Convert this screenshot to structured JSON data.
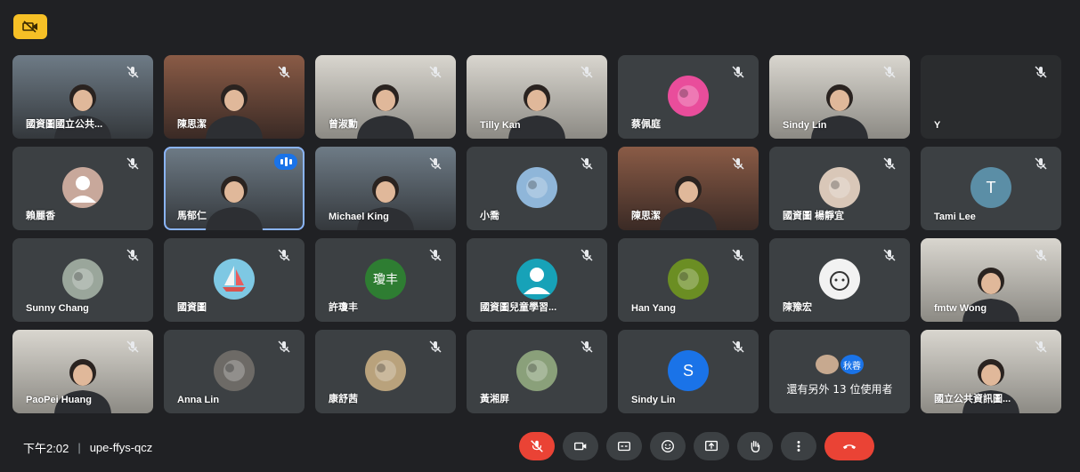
{
  "top_badge_icon": "no-camera-badge-icon",
  "participants": [
    {
      "name": "國資圖國立公共...",
      "kind": "video",
      "tone": "cool"
    },
    {
      "name": "陳思潔",
      "kind": "video",
      "tone": "warm"
    },
    {
      "name": "曾淑勳",
      "kind": "video",
      "tone": "light"
    },
    {
      "name": "Tilly Kan",
      "kind": "video",
      "tone": "light"
    },
    {
      "name": "蔡佩庭",
      "kind": "avatar",
      "avatar_color": "#e94d9b",
      "avatar_icon": "sunset-photo"
    },
    {
      "name": "Sindy Lin",
      "kind": "video",
      "tone": "light"
    },
    {
      "name": "Y",
      "kind": "video",
      "tone": "dark"
    },
    {
      "name": "賴麗香",
      "kind": "avatar",
      "avatar_color": "#c8a89b",
      "avatar_icon": "person-silhouette"
    },
    {
      "name": "馬郁仁",
      "kind": "video",
      "tone": "cool",
      "speaking": true
    },
    {
      "name": "Michael King",
      "kind": "video",
      "tone": "cool"
    },
    {
      "name": "小喬",
      "kind": "avatar",
      "avatar_color": "#8fb6d9",
      "avatar_icon": "building-photo"
    },
    {
      "name": "陳思潔",
      "kind": "video",
      "tone": "warm"
    },
    {
      "name": "國資圖 楊靜宜",
      "kind": "avatar",
      "avatar_color": "#d9c7b8",
      "avatar_icon": "person-photo"
    },
    {
      "name": "Tami Lee",
      "kind": "avatar",
      "avatar_color": "#5b8ea6",
      "avatar_letter": "T"
    },
    {
      "name": "Sunny Chang",
      "kind": "avatar",
      "avatar_color": "#9aa69b",
      "avatar_icon": "cat-photo"
    },
    {
      "name": "國資圖",
      "kind": "avatar",
      "avatar_color": "#7ec8e3",
      "avatar_icon": "sailboat"
    },
    {
      "name": "許瓊丰",
      "kind": "avatar",
      "avatar_color": "#2e7d32",
      "avatar_letter": "瓊丰"
    },
    {
      "name": "國資圖兒童學習...",
      "kind": "avatar",
      "avatar_color": "#17a2b8",
      "avatar_icon": "person-silhouette"
    },
    {
      "name": "Han Yang",
      "kind": "avatar",
      "avatar_color": "#6b8e23",
      "avatar_icon": "flower-photo"
    },
    {
      "name": "陳豫宏",
      "kind": "avatar",
      "avatar_color": "#f2f2f2",
      "avatar_icon": "cartoon-face"
    },
    {
      "name": "fmtw Wong",
      "kind": "video",
      "tone": "light"
    },
    {
      "name": "PaoPei Huang",
      "kind": "video",
      "tone": "light"
    },
    {
      "name": "Anna Lin",
      "kind": "avatar",
      "avatar_color": "#6d6a66",
      "avatar_icon": "cat-photo"
    },
    {
      "name": "康舒茜",
      "kind": "avatar",
      "avatar_color": "#b9a27c",
      "avatar_icon": "dog-photo"
    },
    {
      "name": "黃湘屏",
      "kind": "avatar",
      "avatar_color": "#8aa07a",
      "avatar_icon": "group-photo"
    },
    {
      "name": "Sindy Lin",
      "kind": "avatar",
      "avatar_color": "#1a73e8",
      "avatar_letter": "S"
    },
    {
      "name": "",
      "kind": "others"
    },
    {
      "name": "國立公共資訊圖...",
      "kind": "video",
      "tone": "light"
    }
  ],
  "others_tile": {
    "label": "還有另外 13 位使用者",
    "mini_avatars": [
      {
        "kind": "photo",
        "color": "#c7a98f"
      },
      {
        "kind": "letter",
        "color": "#1a73e8",
        "text": "秋蓉"
      }
    ]
  },
  "meeting": {
    "time": "下午2:02",
    "separator": "|",
    "code": "upe-ffys-qcz"
  },
  "controls": [
    {
      "name": "mic-off",
      "icon": "mic-off-icon",
      "style": "red"
    },
    {
      "name": "camera",
      "icon": "camera-icon",
      "style": "normal"
    },
    {
      "name": "captions",
      "icon": "captions-icon",
      "style": "normal"
    },
    {
      "name": "reactions",
      "icon": "emoji-icon",
      "style": "normal"
    },
    {
      "name": "present",
      "icon": "present-icon",
      "style": "normal"
    },
    {
      "name": "raise-hand",
      "icon": "hand-icon",
      "style": "normal"
    },
    {
      "name": "more-options",
      "icon": "more-vert-icon",
      "style": "normal"
    },
    {
      "name": "leave-call",
      "icon": "phone-hangup-icon",
      "style": "leave"
    }
  ],
  "colors": {
    "background": "#202124",
    "tile": "#3c4043",
    "accent": "#1a73e8",
    "danger": "#ea4335",
    "badge": "#f6c026"
  }
}
